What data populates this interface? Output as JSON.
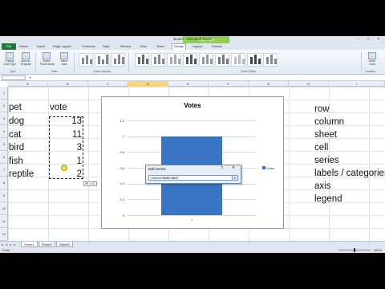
{
  "window": {
    "title": "Book1 - Microsoft Excel",
    "tools_tab": "Chart Tools",
    "controls": "– □ ×"
  },
  "ribbon": {
    "file_tab": "File",
    "tabs": [
      "Home",
      "Insert",
      "Page Layout",
      "Formulas",
      "Data",
      "Review",
      "View",
      "Team",
      "Design",
      "Layout",
      "Format"
    ],
    "active_tab": "Design",
    "buttons": [
      {
        "label": "Change Chart Type"
      },
      {
        "label": "Save As Template"
      },
      {
        "label": "Switch Row/Column"
      },
      {
        "label": "Select Data"
      },
      {
        "label": "Move Chart"
      }
    ],
    "groups": [
      "Type",
      "Data",
      "Chart Layouts",
      "Chart Styles",
      "Location"
    ]
  },
  "formula_bar": {
    "name_box": "",
    "fx": "fx"
  },
  "columns": [
    "A",
    "B",
    "C",
    "D",
    "E",
    "F",
    "G",
    "H",
    "I"
  ],
  "rows": [
    "1",
    "2",
    "3",
    "4",
    "5",
    "6",
    "7",
    "8",
    "9",
    "10",
    "11",
    "12"
  ],
  "table": {
    "header": {
      "pet": "pet",
      "vote": "vote"
    },
    "rows": [
      {
        "pet": "dog",
        "vote": "13"
      },
      {
        "pet": "cat",
        "vote": "11"
      },
      {
        "pet": "bird",
        "vote": "3"
      },
      {
        "pet": "fish",
        "vote": "1"
      },
      {
        "pet": "reptile",
        "vote": "2"
      }
    ]
  },
  "selection_tip": "5R x 1C",
  "chart_data": {
    "type": "bar",
    "title": "Votes",
    "categories": [
      "1"
    ],
    "series": [
      {
        "name": "Votes",
        "values": [
          1
        ]
      }
    ],
    "yticks": [
      "1.2",
      "1",
      "0.8",
      "0.6",
      "0.4",
      "0.2",
      "0"
    ],
    "ylim": [
      0,
      1.2
    ],
    "grid": true,
    "legend": "right"
  },
  "dialog": {
    "title": "Edit Series",
    "help": "?",
    "close": "✕",
    "input_value": "=Sheet1!$B$3:$B$7",
    "collapse": "▪"
  },
  "sheet_tabs": {
    "nav": "◂ ◂ ▸ ▸",
    "tabs": [
      "Sheet1",
      "Sheet2",
      "Sheet3"
    ]
  },
  "status": {
    "mode": "Point",
    "zoom": "100%"
  },
  "vocab": [
    "row",
    "column",
    "sheet",
    "cell",
    "series",
    "labels / categories",
    "axis",
    "legend"
  ],
  "colors": {
    "bar": "#3a75c4",
    "file_tab": "#1f7a3a",
    "tools_tab": "#8fd14f"
  }
}
